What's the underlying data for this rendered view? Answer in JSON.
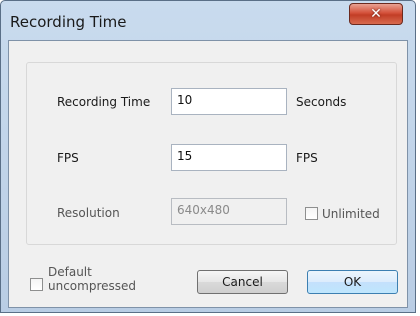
{
  "window": {
    "title": "Recording Time",
    "close_glyph": "✕",
    "close_icon": "close-icon"
  },
  "form": {
    "recording_time": {
      "label": "Recording Time",
      "value": "10",
      "unit": "Seconds"
    },
    "fps": {
      "label": "FPS",
      "value": "15",
      "unit": "FPS"
    },
    "resolution": {
      "label": "Resolution",
      "value": "640x480"
    },
    "unlimited": {
      "label": "Unlimited",
      "checked": false
    }
  },
  "footer": {
    "default_uncompressed": {
      "label_line1": "Default",
      "label_line2": "uncompressed",
      "checked": false
    },
    "cancel_label": "Cancel",
    "ok_label": "OK"
  }
}
